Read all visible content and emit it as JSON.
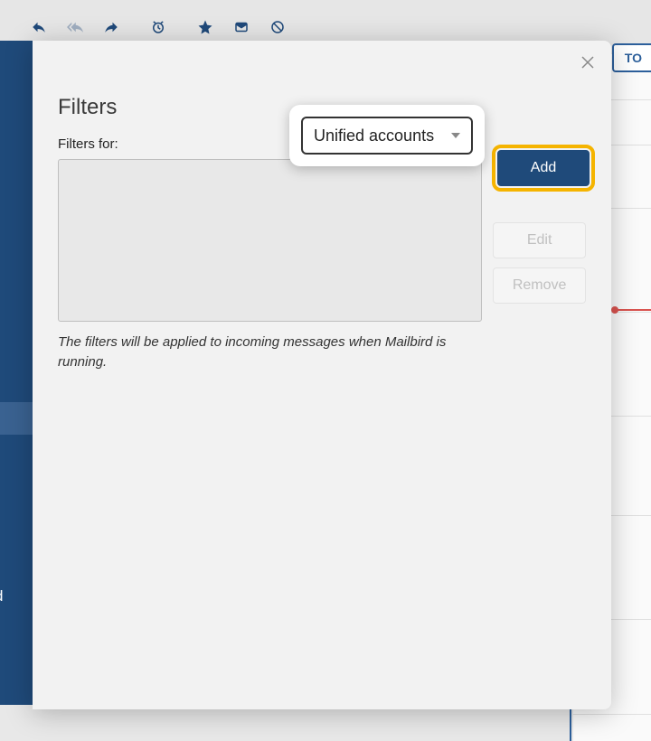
{
  "toolbar": {
    "icons": [
      "reply",
      "reply-all",
      "forward",
      "snooze",
      "star",
      "archive",
      "block"
    ]
  },
  "top_right_button": "TO",
  "modal": {
    "title": "Filters",
    "filters_for_label": "Filters for:",
    "dropdown_selected": "Unified accounts",
    "buttons": {
      "add": "Add",
      "edit": "Edit",
      "remove": "Remove"
    },
    "hint": "The filters will be applied to incoming messages when Mailbird is running."
  }
}
